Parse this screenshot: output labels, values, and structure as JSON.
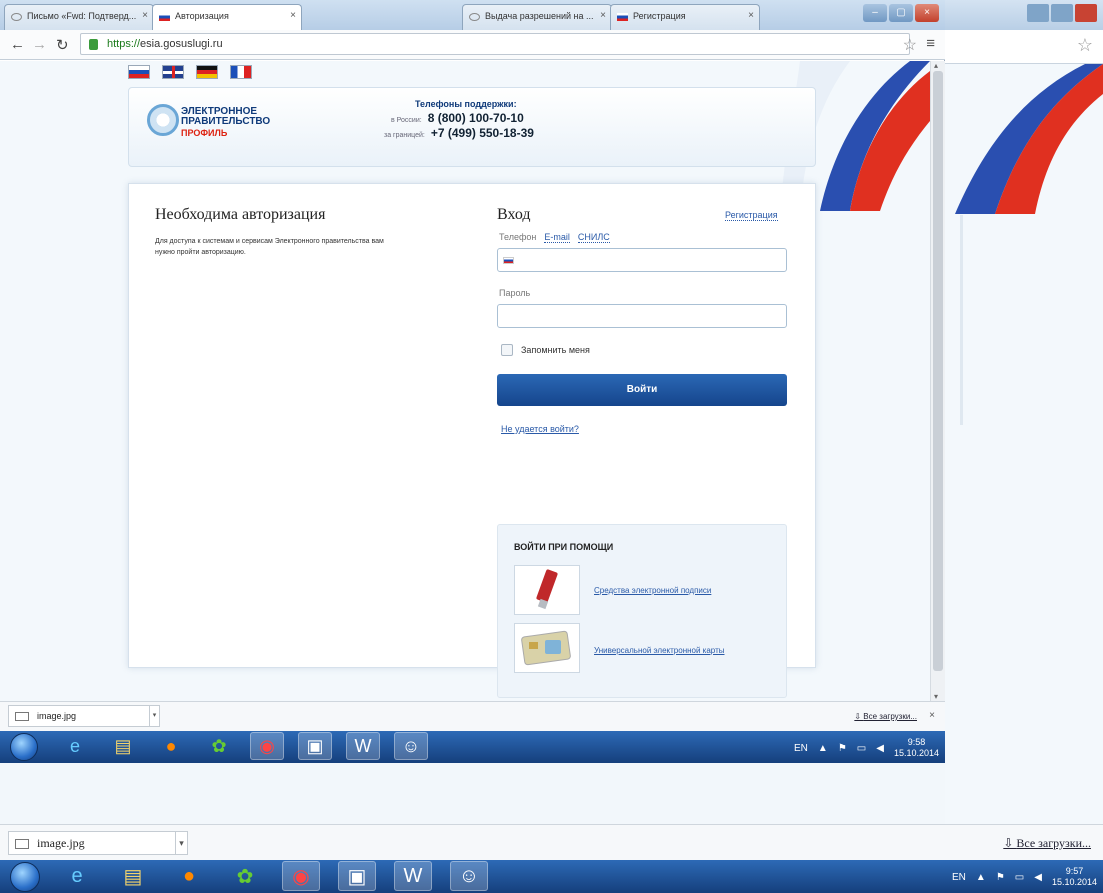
{
  "browser": {
    "tabs": [
      {
        "label": "Письмо «Fwd: Подтверд...",
        "active": false
      },
      {
        "label": "Авторизация",
        "active": true
      },
      {
        "label": "Выдача разрешений на ...",
        "active": false
      },
      {
        "label": "Регистрация",
        "active": false
      }
    ],
    "url_scheme": "https://",
    "url_host": "esia.gosuslugi.ru"
  },
  "header": {
    "logo_line1": "ЭЛЕКТРОННОЕ",
    "logo_line2": "ПРАВИТЕЛЬСТВО",
    "logo_sub": "ПРОФИЛЬ",
    "support_title": "Телефоны поддержки:",
    "russia_label": "в России:",
    "russia_phone": "8 (800) 100-70-10",
    "abroad_label": "за границей:",
    "abroad_phone": "+7 (499) 550-18-39"
  },
  "auth": {
    "heading": "Необходима авторизация",
    "description": "Для доступа к системам и сервисам Электронного правительства вам нужно пройти авторизацию.",
    "login_heading": "Вход",
    "register_link": "Регистрация",
    "tab_phone": "Телефон",
    "tab_email": "E-mail",
    "tab_snils": "СНИЛС",
    "password_label": "Пароль",
    "remember_label": "Запомнить меня",
    "login_button": "Войти",
    "cant_login": "Не удается войти?",
    "alt_title": "ВОЙТИ ПРИ ПОМОЩИ",
    "alt_esign": "Средства электронной подписи",
    "alt_card": "Универсальной электронной карты"
  },
  "downloads": {
    "file_name": "image.jpg",
    "all_downloads": "Все загрузки...",
    "close": "×"
  },
  "taskbar": {
    "lang": "EN",
    "time": "9:58",
    "date": "15.10.2014"
  },
  "background": {
    "file_name": "image.jpg",
    "all_downloads": "Все загрузки...",
    "lang": "EN",
    "time": "9:57",
    "date": "15.10.2014"
  },
  "colors": {
    "brand_blue": "#15458c",
    "link": "#2a5aa8",
    "accent_red": "#d21"
  }
}
